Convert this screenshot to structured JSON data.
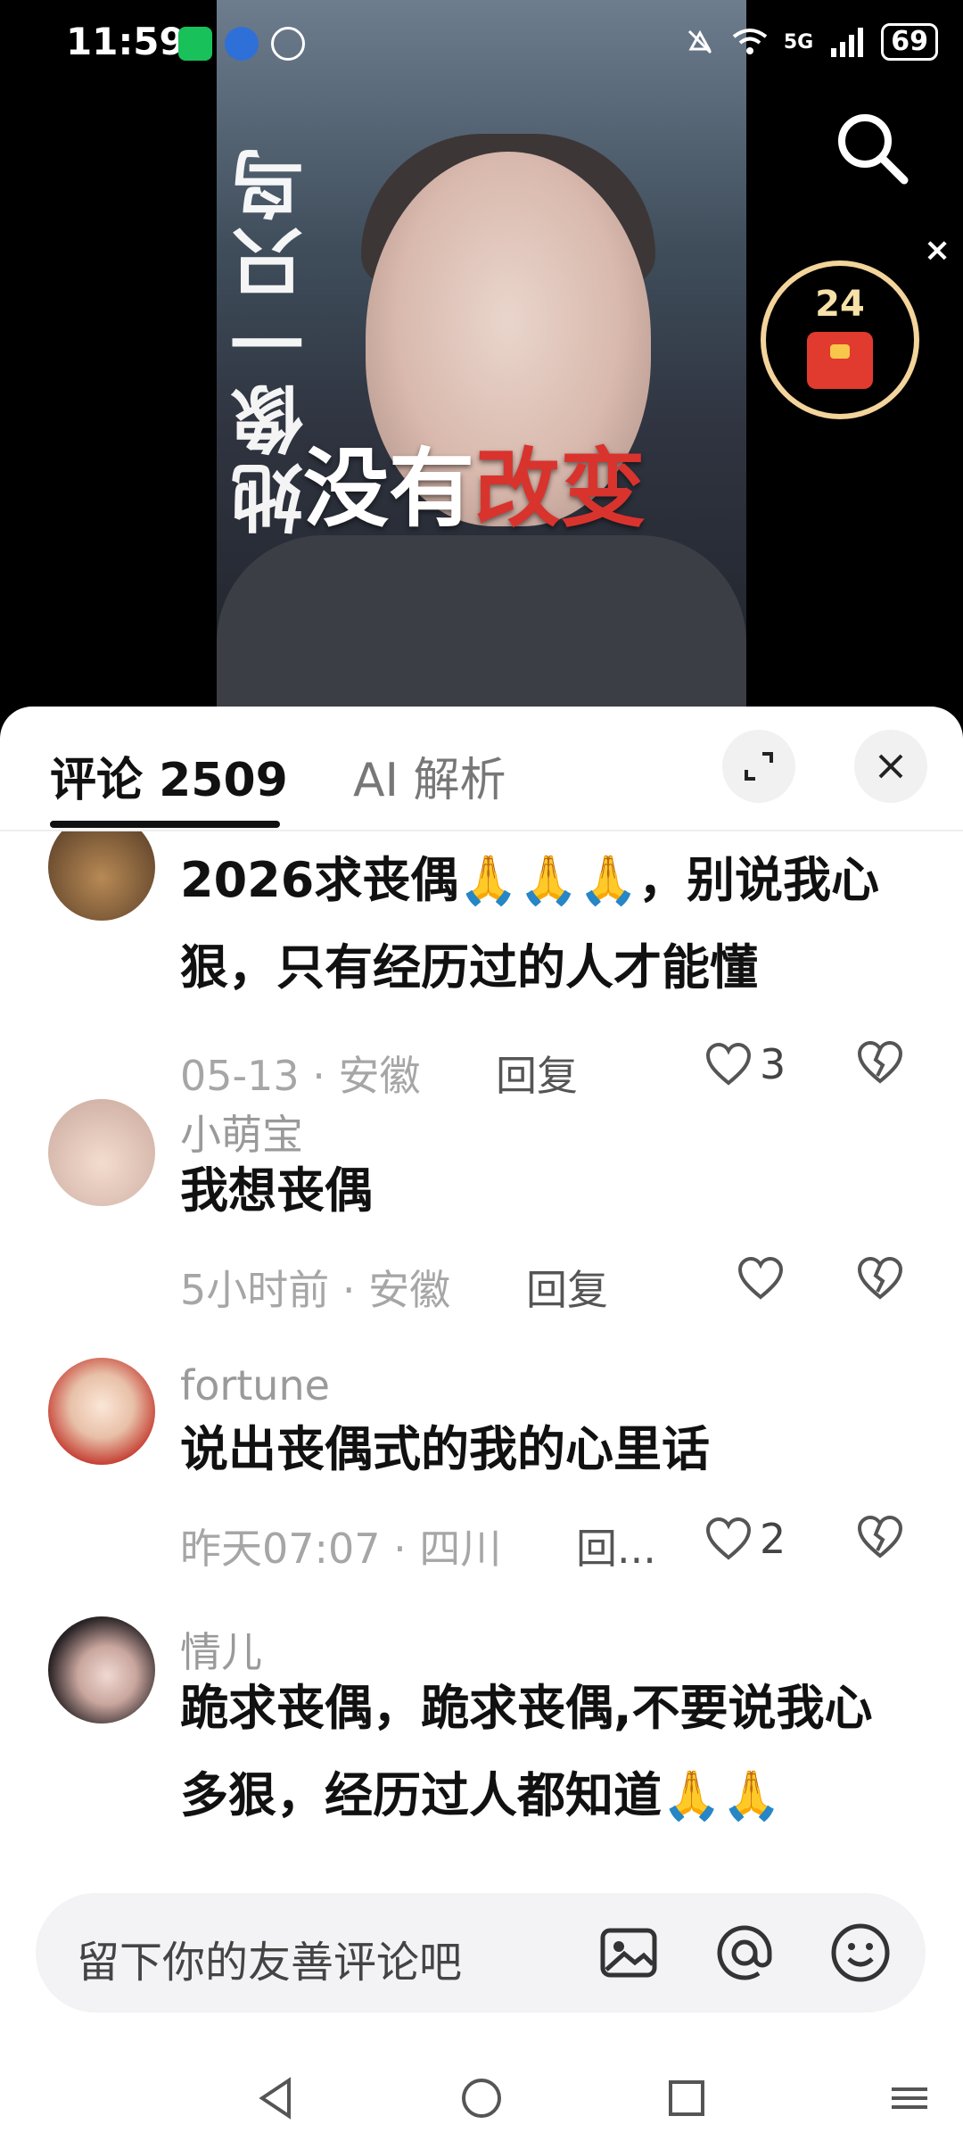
{
  "status": {
    "time": "11:59",
    "network": "5G",
    "battery": "69"
  },
  "video": {
    "side_text": "她像一只鸟",
    "caption_white": "没有",
    "caption_red": "改变",
    "redpacket_count": "24",
    "close_symbol": "×"
  },
  "sheet": {
    "tab_comments": "评论 2509",
    "tab_ai": "AI 解析"
  },
  "comments": [
    {
      "username": "",
      "text": "2026求丧偶🙏🙏🙏，别说我心狠，只有经历过的人才能懂",
      "meta": "05-13 · 安徽",
      "reply": "回复",
      "likes": "3"
    },
    {
      "username": "小萌宝",
      "text": "我想丧偶",
      "meta": "5小时前 · 安徽",
      "reply": "回复",
      "likes": ""
    },
    {
      "username": "fortune",
      "text": "说出丧偶式的我的心里话",
      "meta": "昨天07:07 · 四川",
      "reply": "回...",
      "likes": "2"
    },
    {
      "username": "情儿",
      "text": "跪求丧偶，跪求丧偶,不要说我心多狠，经历过人都知道🙏🙏",
      "meta": "",
      "reply": "",
      "likes": ""
    }
  ],
  "input": {
    "placeholder": "留下你的友善评论吧"
  },
  "colors": {
    "accent_red": "#d9332e",
    "redpacket_gold": "#f3d49a"
  }
}
